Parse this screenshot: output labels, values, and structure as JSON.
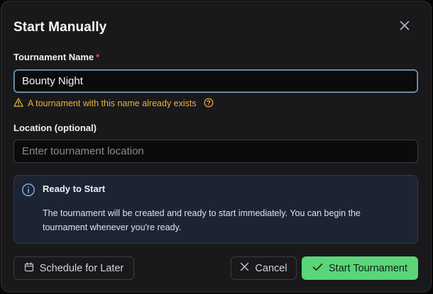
{
  "dialog": {
    "title": "Start Manually",
    "close_icon": "close-icon"
  },
  "tournament_name": {
    "label": "Tournament Name",
    "required_marker": "*",
    "value": "Bounty Night",
    "warning_text": "A tournament with this name already exists",
    "warning_icon": "warning-triangle-icon",
    "help_icon": "help-circle-icon"
  },
  "location": {
    "label": "Location (optional)",
    "value": "",
    "placeholder": "Enter tournament location"
  },
  "info": {
    "icon": "info-icon",
    "title": "Ready to Start",
    "body": "The tournament will be created and ready to start immediately. You can begin the tournament whenever you're ready."
  },
  "actions": {
    "schedule_label": "Schedule for Later",
    "cancel_label": "Cancel",
    "start_label": "Start Tournament"
  },
  "colors": {
    "accent_green": "#5ad679",
    "warning": "#e8b13a",
    "required": "#ef4444",
    "info_blue": "#7fa6e0"
  }
}
